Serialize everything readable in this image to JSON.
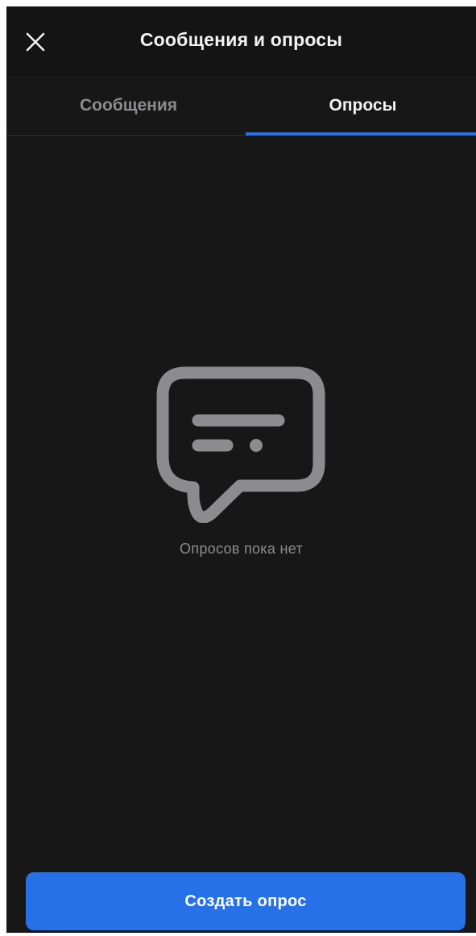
{
  "header": {
    "title": "Сообщения и опросы",
    "close_icon": "close-icon"
  },
  "tabs": [
    {
      "label": "Сообщения",
      "active": false
    },
    {
      "label": "Опросы",
      "active": true
    }
  ],
  "empty_state": {
    "icon": "chat-bubble-icon",
    "text": "Опросов пока нет"
  },
  "footer": {
    "create_button_label": "Создать опрос"
  },
  "colors": {
    "background": "#171718",
    "header_background": "#141415",
    "accent": "#2670e8",
    "text_primary": "#f2f2f2",
    "text_secondary": "#8c8c8e"
  }
}
